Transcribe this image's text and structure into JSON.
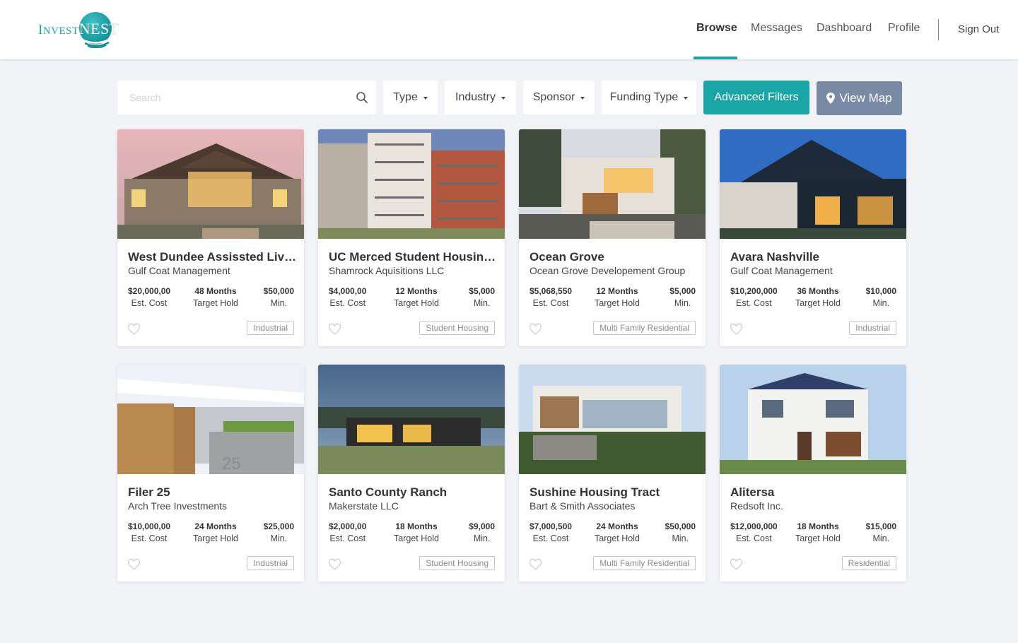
{
  "brand": {
    "part1": "Invest",
    "part2": "Nest"
  },
  "nav": {
    "items": [
      "Browse",
      "Messages",
      "Dashboard",
      "Profile"
    ],
    "active": "Browse",
    "signout": "Sign Out"
  },
  "filters": {
    "search_placeholder": "Search",
    "type": "Type",
    "industry": "Industry",
    "sponsor": "Sponsor",
    "funding_type": "Funding Type",
    "advanced": "Advanced Filters",
    "view_map": "View Map"
  },
  "colors": {
    "accent": "#1aa6a6",
    "map_button": "#7a8aa5",
    "background": "#f2f3f6"
  },
  "stat_labels": {
    "cost": "Est. Cost",
    "hold": "Target Hold",
    "min": "Min."
  },
  "listings": [
    {
      "title": "West Dundee Assissted Living",
      "sponsor": "Gulf Coat Management",
      "cost": "$20,000,00",
      "hold": "48 Months",
      "min": "$50,000",
      "tag": "Industrial",
      "image": "lodge-building-dusk"
    },
    {
      "title": "UC Merced Student Housing…",
      "sponsor": "Shamrock Aquisitions LLC",
      "cost": "$4,000,00",
      "hold": "12 Months",
      "min": "$5,000",
      "tag": "Student Housing",
      "image": "apartment-building"
    },
    {
      "title": "Ocean Grove",
      "sponsor": "Ocean Grove Developement Group",
      "cost": "$5,068,550",
      "hold": "12 Months",
      "min": "$5,000",
      "tag": "Multi Family Residential",
      "image": "modern-house"
    },
    {
      "title": "Avara Nashville",
      "sponsor": "Gulf Coat Management",
      "cost": "$10,200,000",
      "hold": "36 Months",
      "min": "$10,000",
      "tag": "Industrial",
      "image": "dark-modern-house"
    },
    {
      "title": "Filer 25",
      "sponsor": "Arch Tree Investments",
      "cost": "$10,000,00",
      "hold": "24 Months",
      "min": "$25,000",
      "tag": "Industrial",
      "image": "house-entrance-25"
    },
    {
      "title": "Santo County Ranch",
      "sponsor": "Makerstate LLC",
      "cost": "$2,000,00",
      "hold": "18 Months",
      "min": "$9,000",
      "tag": "Student Housing",
      "image": "ranch-house-dusk"
    },
    {
      "title": "Sushine Housing Tract",
      "sponsor": "Bart & Smith Associates",
      "cost": "$7,000,500",
      "hold": "24 Months",
      "min": "$50,000",
      "tag": "Multi Family Residential",
      "image": "hillside-modern-house"
    },
    {
      "title": "Alitersa",
      "sponsor": "Redsoft Inc.",
      "cost": "$12,000,000",
      "hold": "18 Months",
      "min": "$15,000",
      "tag": "Residential",
      "image": "white-two-story-house"
    }
  ]
}
